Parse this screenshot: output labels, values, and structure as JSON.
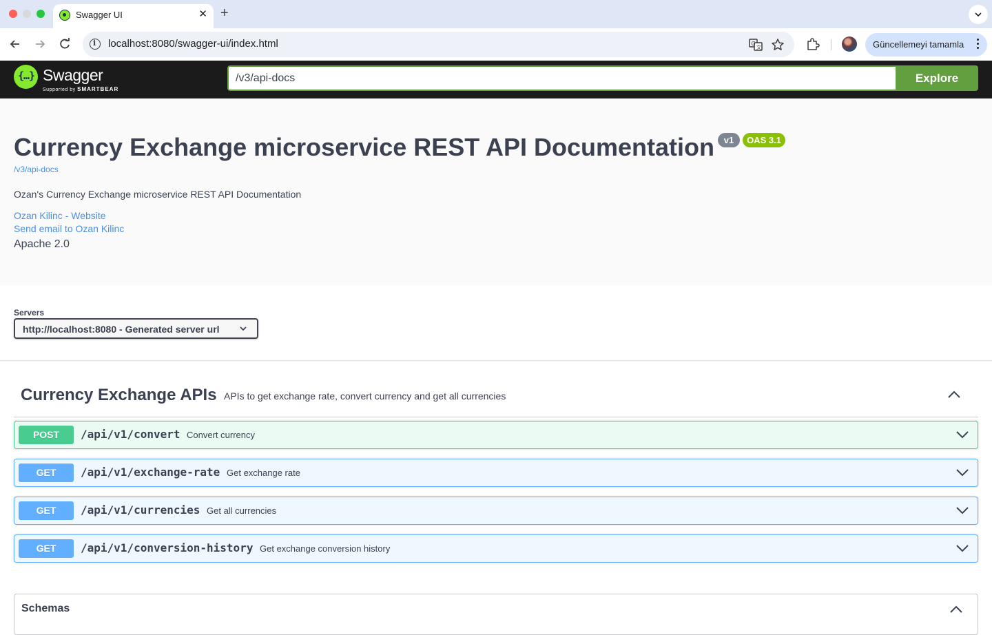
{
  "browser": {
    "tab_title": "Swagger UI",
    "url": "localhost:8080/swagger-ui/index.html",
    "update_label": "Güncellemeyi tamamla"
  },
  "topbar": {
    "logo_text": "Swagger",
    "logo_sub_prefix": "Supported by",
    "logo_sub_brand": "SMARTBEAR",
    "url_value": "/v3/api-docs",
    "explore_label": "Explore"
  },
  "info": {
    "title": "Currency Exchange microservice REST API Documentation",
    "version_badge": "v1",
    "oas_badge": "OAS 3.1",
    "spec_link": "/v3/api-docs",
    "description": "Ozan's Currency Exchange microservice REST API Documentation",
    "contact_website": "Ozan Kilinc - Website",
    "contact_email": "Send email to Ozan Kilinc",
    "license": "Apache 2.0"
  },
  "servers": {
    "label": "Servers",
    "selected": "http://localhost:8080 - Generated server url"
  },
  "tag": {
    "name": "Currency Exchange APIs",
    "description": "APIs to get exchange rate, convert currency and get all currencies"
  },
  "operations": [
    {
      "method": "POST",
      "path": "/api/v1/convert",
      "summary": "Convert currency"
    },
    {
      "method": "GET",
      "path": "/api/v1/exchange-rate",
      "summary": "Get exchange rate"
    },
    {
      "method": "GET",
      "path": "/api/v1/currencies",
      "summary": "Get all currencies"
    },
    {
      "method": "GET",
      "path": "/api/v1/conversion-history",
      "summary": "Get exchange conversion history"
    }
  ],
  "schemas": {
    "title": "Schemas"
  },
  "colors": {
    "post": "#49cc90",
    "get": "#61afe6",
    "explore": "#62a03f",
    "link": "#4990e2",
    "topbar": "#1b1b1b"
  }
}
